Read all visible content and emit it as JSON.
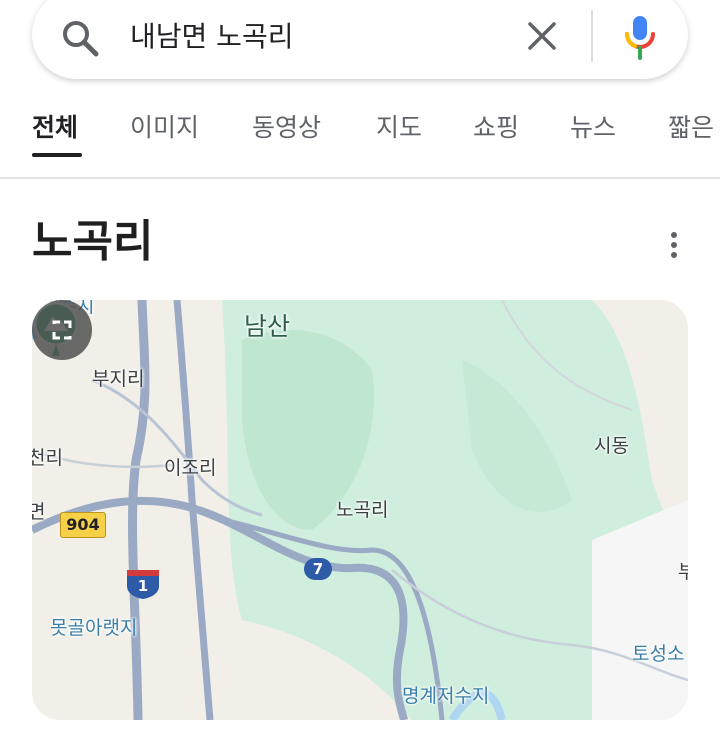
{
  "search": {
    "query": "내남면 노곡리"
  },
  "tabs": [
    {
      "label": "전체",
      "active": true
    },
    {
      "label": "이미지"
    },
    {
      "label": "동영상"
    },
    {
      "label": "지도"
    },
    {
      "label": "쇼핑"
    },
    {
      "label": "뉴스"
    },
    {
      "label": "짧은"
    }
  ],
  "knowledge_panel": {
    "title": "노곡리"
  },
  "map": {
    "labels": {
      "top_left_partial": "녁수지",
      "namsan": "남산",
      "bujiri": "부지리",
      "sidong": "시동",
      "cheolli": "천리",
      "ijori": "이조리",
      "nogokri": "노곡리",
      "myeon_partial": "면",
      "motgol": "못골아랫지",
      "toseong": "토성소",
      "right_edge_partial": "부",
      "myeonggye": "명계저수지"
    },
    "routes": {
      "r904": "904",
      "r7": "7",
      "r1": "1"
    }
  },
  "icons": {
    "search": "search-icon",
    "clear": "close-icon",
    "mic": "mic-icon",
    "more": "more-vert-icon",
    "expand": "expand-icon",
    "peak": "mountain-icon"
  },
  "colors": {
    "map_forest": "#cfeedd",
    "map_land": "#f1efe8",
    "road": "#9aa9c4",
    "highway_shield": "#2e5ba8",
    "route904": "#f6d047"
  }
}
